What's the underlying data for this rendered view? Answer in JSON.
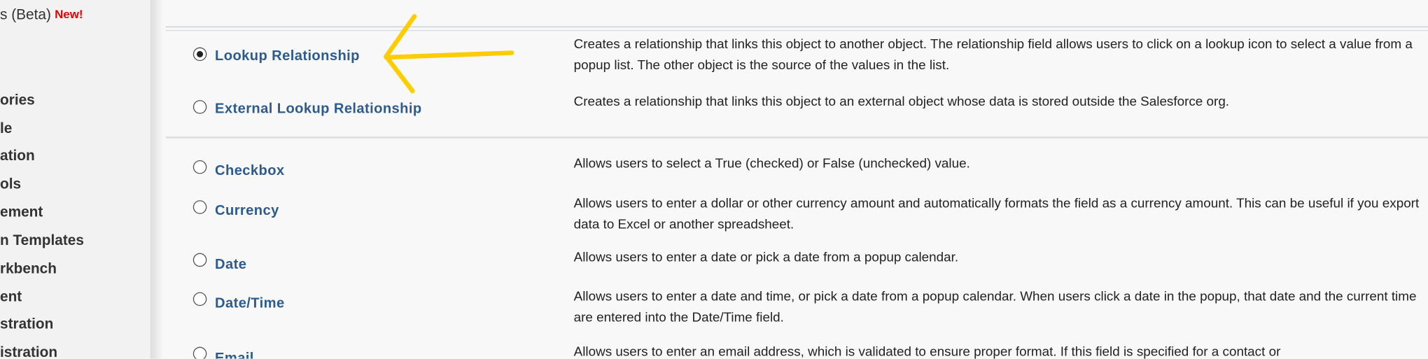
{
  "sidebar": {
    "beta_item": "s (Beta)",
    "new_badge": "New!",
    "items": [
      "ories",
      "le",
      "ation",
      "ols",
      "ement",
      "n Templates",
      "rkbench",
      "ent",
      "stration",
      "istration"
    ]
  },
  "field_types": [
    {
      "label": "Lookup Relationship",
      "selected": true,
      "description": "Creates a relationship that links this object to another object. The relationship field allows users to click on a lookup icon to select a value from a popup list. The other object is the source of the values in the list."
    },
    {
      "label": "External Lookup Relationship",
      "selected": false,
      "description": "Creates a relationship that links this object to an external object whose data is stored outside the Salesforce org."
    },
    {
      "label": "Checkbox",
      "selected": false,
      "description": "Allows users to select a True (checked) or False (unchecked) value."
    },
    {
      "label": "Currency",
      "selected": false,
      "description": "Allows users to enter a dollar or other currency amount and automatically formats the field as a currency amount. This can be useful if you export data to Excel or another spreadsheet."
    },
    {
      "label": "Date",
      "selected": false,
      "description": "Allows users to enter a date or pick a date from a popup calendar."
    },
    {
      "label": "Date/Time",
      "selected": false,
      "description": "Allows users to enter a date and time, or pick a date from a popup calendar. When users click a date in the popup, that date and the current time are entered into the Date/Time field."
    },
    {
      "label": "Email",
      "selected": false,
      "description": "Allows users to enter an email address, which is validated to ensure proper format. If this field is specified for a contact or"
    }
  ],
  "colors": {
    "link": "#2d5b8e",
    "annotation_arrow": "#ffcc00",
    "new_badge": "#ee0000"
  },
  "annotation": {
    "icon": "hand-drawn-arrow-icon"
  }
}
